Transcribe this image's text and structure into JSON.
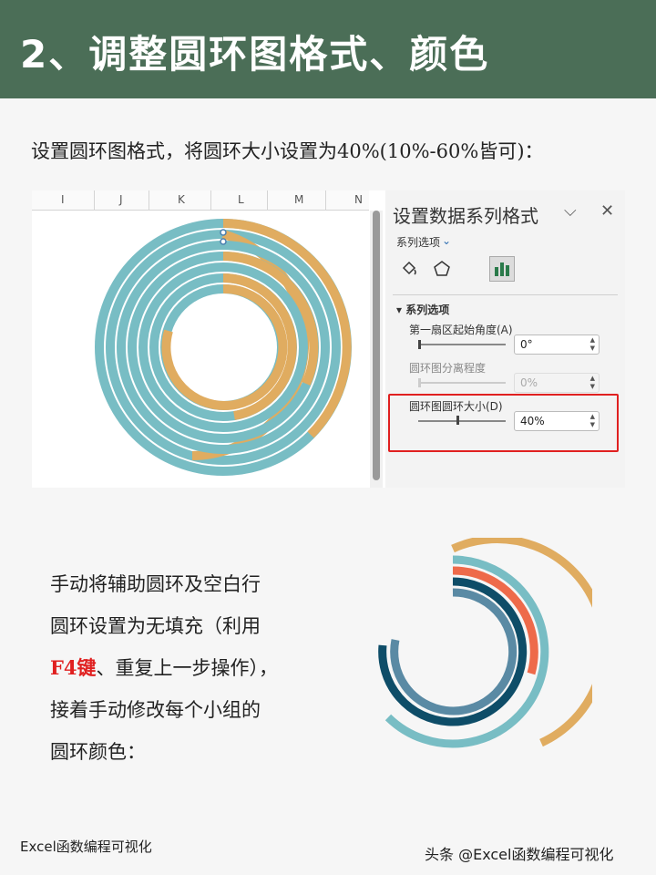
{
  "header": {
    "title": "2、调整圆环图格式、颜色"
  },
  "intro": {
    "text": "设置圆环图格式，将圆环大小设置为40%(10%-60%皆可)："
  },
  "sheet": {
    "columns": [
      "I",
      "J",
      "K",
      "L",
      "M",
      "N"
    ]
  },
  "format_pane": {
    "title": "设置数据系列格式",
    "series_options_dropdown": "系列选项",
    "section": "系列选项",
    "fields": [
      {
        "label": "第一扇区起始角度(A)",
        "value": "0°"
      },
      {
        "label": "圆环图分离程度",
        "value": "0%"
      },
      {
        "label": "圆环图圆环大小(D)",
        "value": "40%"
      }
    ]
  },
  "body": {
    "lines": [
      "手动将辅助圆环及空白行",
      "圆环设置为无填充（利用"
    ],
    "highlight": "F4键",
    "line3_rest": "、重复上一步操作），",
    "lines2": [
      "接着手动修改每个小组的",
      "圆环颜色："
    ]
  },
  "footer": {
    "left": "Excel函数编程可视化",
    "right": "头条 @Excel函数编程可视化"
  },
  "colors": {
    "header_bg": "#4b6e57",
    "teal": "#78bdc4",
    "gold": "#e0ac60",
    "orange_red": "#ee6a4a",
    "dark_blue": "#0e4d68",
    "steel": "#5a8aa4",
    "highlight_red": "#e02020"
  },
  "arcs": [
    {
      "color": "#e0ac60",
      "fraction": 0.5
    },
    {
      "color": "#78bdc4",
      "fraction": 0.55
    },
    {
      "color": "#ee6a4a",
      "fraction": 0.25
    },
    {
      "color": "#0e4d68",
      "fraction": 0.62
    },
    {
      "color": "#5a8aa4",
      "fraction": 0.6
    }
  ]
}
